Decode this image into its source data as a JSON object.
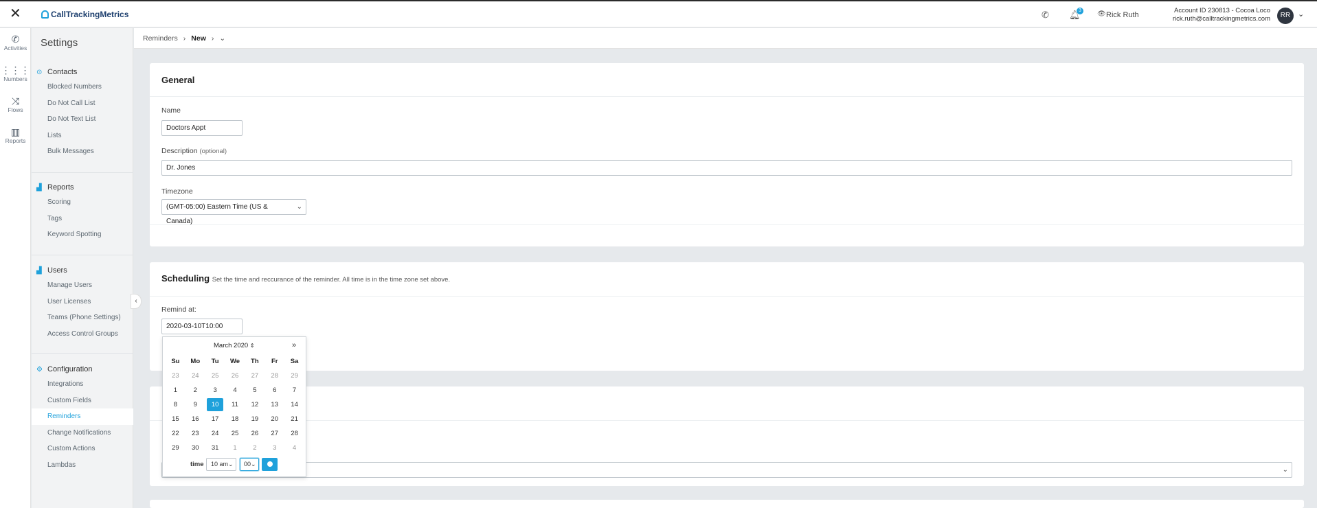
{
  "topbar": {
    "close_icon": "close-icon",
    "brand": "CallTrackingMetrics",
    "notifications_count": "3",
    "user_name": "Rick Ruth",
    "account_line": "Account ID 230813  -  Cocoa Loco",
    "email": "rick.ruth@calltrackingmetrics.com",
    "avatar_initials": "RR"
  },
  "rail": {
    "items": [
      {
        "label": "Activities",
        "icon": "phone-icon"
      },
      {
        "label": "Numbers",
        "icon": "grid-icon"
      },
      {
        "label": "Flows",
        "icon": "shuffle-icon"
      },
      {
        "label": "Reports",
        "icon": "chart-icon"
      }
    ]
  },
  "sidebar": {
    "title": "Settings",
    "contacts": {
      "heading": "Contacts",
      "items": [
        "Blocked Numbers",
        "Do Not Call List",
        "Do Not Text List",
        "Lists",
        "Bulk Messages"
      ]
    },
    "reports": {
      "heading": "Reports",
      "items": [
        "Scoring",
        "Tags",
        "Keyword Spotting"
      ]
    },
    "users": {
      "heading": "Users",
      "items": [
        "Manage Users",
        "User Licenses",
        "Teams (Phone Settings)",
        "Access Control Groups"
      ]
    },
    "configuration": {
      "heading": "Configuration",
      "items": [
        "Integrations",
        "Custom Fields",
        "Reminders",
        "Change Notifications",
        "Custom Actions",
        "Lambdas"
      ],
      "active": "Reminders"
    }
  },
  "breadcrumb": {
    "root": "Reminders",
    "current": "New"
  },
  "general": {
    "heading": "General",
    "name_label": "Name",
    "name_value": "Doctors Appt",
    "description_label": "Description",
    "description_optional": "(optional)",
    "description_value": "Dr. Jones",
    "timezone_label": "Timezone",
    "timezone_value": "(GMT-05:00) Eastern Time (US & Canada)"
  },
  "scheduling": {
    "heading": "Scheduling",
    "subtitle": "Set the time and reccurance of the reminder. All time is in the time zone set above.",
    "remind_label": "Remind at:",
    "remind_value": "2020-03-10T10:00"
  },
  "calendar": {
    "month_label": "March 2020",
    "next_label": "»",
    "weekdays": [
      "Su",
      "Mo",
      "Tu",
      "We",
      "Th",
      "Fr",
      "Sa"
    ],
    "weeks": [
      [
        "23",
        "24",
        "25",
        "26",
        "27",
        "28",
        "29"
      ],
      [
        "1",
        "2",
        "3",
        "4",
        "5",
        "6",
        "7"
      ],
      [
        "8",
        "9",
        "10",
        "11",
        "12",
        "13",
        "14"
      ],
      [
        "15",
        "16",
        "17",
        "18",
        "19",
        "20",
        "21"
      ],
      [
        "22",
        "23",
        "24",
        "25",
        "26",
        "27",
        "28"
      ],
      [
        "29",
        "30",
        "31",
        "1",
        "2",
        "3",
        "4"
      ]
    ],
    "selected_day": "10",
    "time_label": "time",
    "hour_value": "10 am",
    "minute_value": "00"
  },
  "colors": {
    "accent": "#1fa1db",
    "background": "#e6e9ec",
    "panel": "#ffffff"
  }
}
